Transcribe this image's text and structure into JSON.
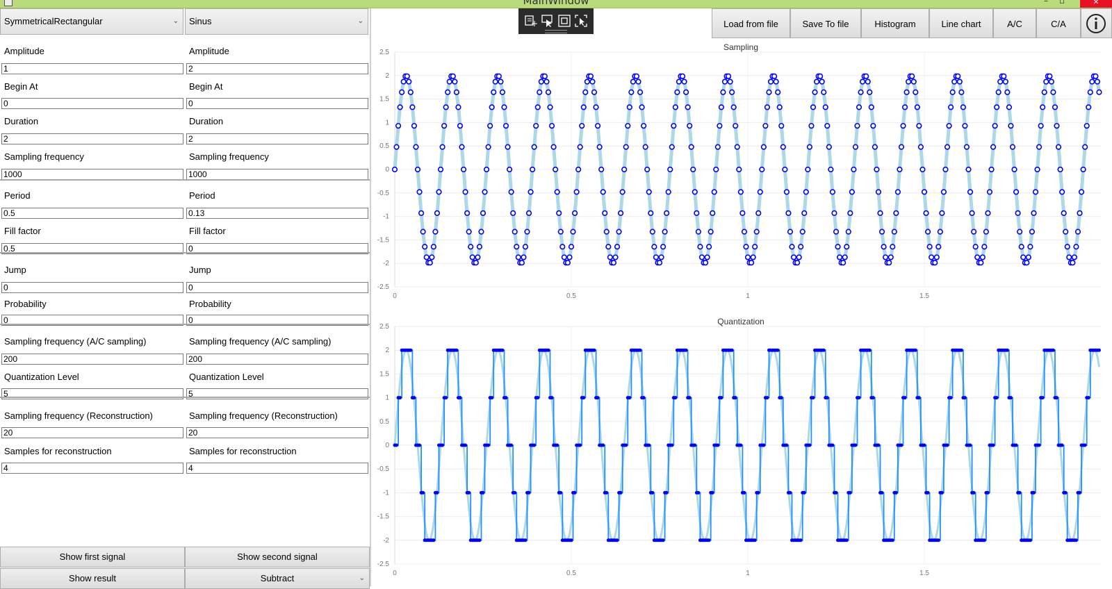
{
  "window": {
    "title": "MainWindow",
    "close_label": "✕"
  },
  "left": {
    "combo_first": "SymmetricalRectangular",
    "combo_second": "Sinus",
    "fields": [
      {
        "label": "Amplitude",
        "first": "1",
        "second": "2"
      },
      {
        "label": "Begin At",
        "first": "0",
        "second": "0"
      },
      {
        "label": "Duration",
        "first": "2",
        "second": "2"
      },
      {
        "label": "Sampling frequency",
        "first": "1000",
        "second": "1000"
      },
      {
        "label": "Period",
        "first": "0.5",
        "second": "0.13"
      },
      {
        "label": "Fill factor",
        "first": "0.5",
        "second": "0"
      },
      {
        "label": "Jump",
        "first": "0",
        "second": "0"
      },
      {
        "label": "Probability",
        "first": "0",
        "second": "0"
      },
      {
        "label": "Sampling frequency (A/C sampling)",
        "first": "200",
        "second": "200"
      },
      {
        "label": "Quantization Level",
        "first": "5",
        "second": "5"
      },
      {
        "label": "Sampling frequency (Reconstruction)",
        "first": "20",
        "second": "20"
      },
      {
        "label": "Samples for reconstruction",
        "first": "4",
        "second": "4"
      }
    ],
    "show_first_label": "Show first signal",
    "show_second_label": "Show second signal",
    "show_result_label": "Show result",
    "operation_selected": "Subtract"
  },
  "toolbar": {
    "load_label": "Load from file",
    "save_label": "Save To file",
    "histogram_label": "Histogram",
    "linechart_label": "Line chart",
    "ac_label": "A/C",
    "ca_label": "C/A",
    "info_icon": "info-icon"
  },
  "colors": {
    "signal_line": "#add8e6",
    "sample_marker": "#0000ff",
    "quant_line": "#1e90ff",
    "titlebar": "#b9db7c"
  },
  "chart_data": [
    {
      "type": "scatter",
      "title": "Sampling",
      "xlim": [
        0,
        2
      ],
      "ylim": [
        -2.5,
        2.5
      ],
      "x_ticks": [
        "0",
        "0.5",
        "1",
        "1.5"
      ],
      "y_ticks": [
        "2.5",
        "2",
        "1.5",
        "1",
        "0.5",
        "0",
        "-0.5",
        "-1",
        "-1.5",
        "-2",
        "-2.5"
      ],
      "grid": true,
      "series": [
        {
          "style": "line",
          "signal": "sinus",
          "amplitude": 2,
          "period": 0.13,
          "sample_rate": 1000
        },
        {
          "style": "markers",
          "signal": "sinus",
          "amplitude": 2,
          "period": 0.13,
          "sample_rate": 200
        }
      ]
    },
    {
      "type": "line",
      "title": "Quantization",
      "xlim": [
        0,
        2
      ],
      "ylim": [
        -2.5,
        2.5
      ],
      "x_ticks": [
        "0",
        "0.5",
        "1",
        "1.5"
      ],
      "y_ticks": [
        "2.5",
        "2",
        "1.5",
        "1",
        "0.5",
        "0",
        "-0.5",
        "-1",
        "-1.5",
        "-2",
        "-2.5"
      ],
      "grid": true,
      "quantization_levels": [
        -2,
        -1,
        0,
        1,
        2
      ],
      "series": [
        {
          "style": "line",
          "signal": "sinus",
          "amplitude": 2,
          "period": 0.13,
          "sample_rate": 1000
        },
        {
          "style": "step-markers",
          "signal": "quantized sinus",
          "sample_rate": 200
        }
      ]
    }
  ]
}
